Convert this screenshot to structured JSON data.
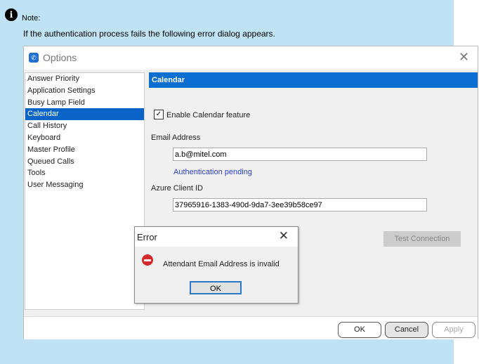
{
  "note": {
    "icon": "info-icon",
    "title": "Note:",
    "text": "If the authentication  process  fails  the following error dialog appears."
  },
  "window": {
    "title": "Options",
    "close": "✕"
  },
  "nav": {
    "items": [
      "Answer Priority",
      "Application Settings",
      "Busy Lamp Field",
      "Calendar",
      "Call History",
      "Keyboard",
      "Master Profile",
      "Queued Calls",
      "Tools",
      "User Messaging"
    ],
    "selected": "Calendar"
  },
  "panel": {
    "header": "Calendar",
    "enable_label": "Enable Calendar feature",
    "enable_checked": true,
    "email_label": "Email Address",
    "email_value": "a.b@mitel.com",
    "auth_status": "Authentication pending",
    "client_id_label": "Azure Client ID",
    "client_id_value": "37965916-1383-490d-9da7-3ee39b58ce97",
    "test_button": "Test Connection"
  },
  "footer": {
    "ok": "OK",
    "cancel": "Cancel",
    "apply": "Apply"
  },
  "error": {
    "title": "Error",
    "close": "✕",
    "message": "Attendant Email Address is invalid",
    "ok": "OK"
  },
  "colors": {
    "accent": "#0a6fd0",
    "note_bg": "#bfe3f4",
    "error_red": "#d42a2a"
  }
}
